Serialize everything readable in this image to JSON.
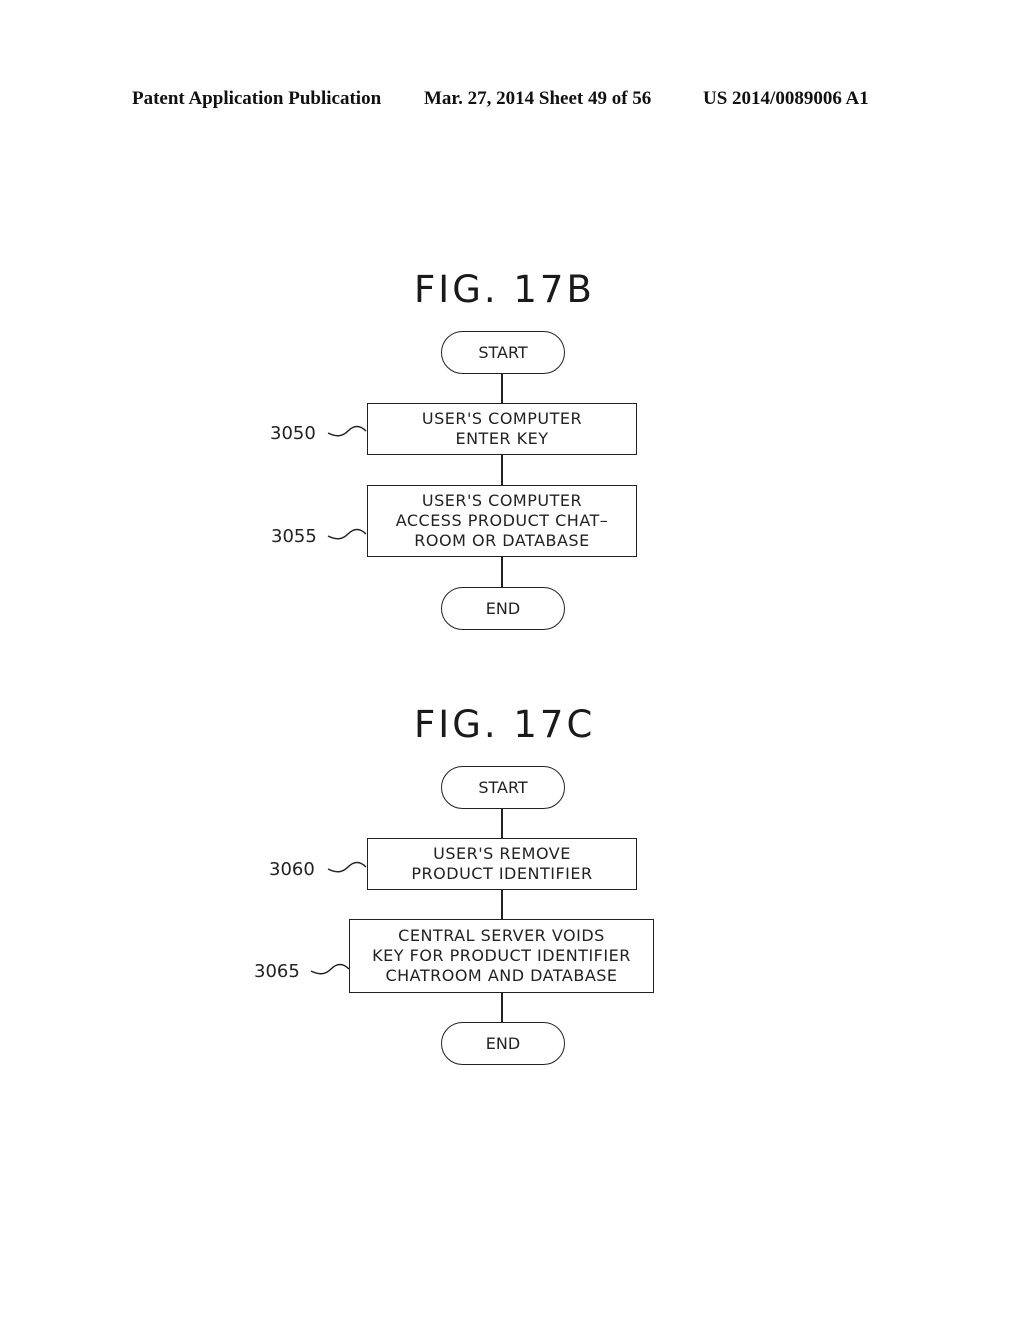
{
  "header": {
    "left": "Patent Application Publication",
    "middle": "Mar. 27, 2014  Sheet 49 of 56",
    "right": "US 2014/0089006 A1"
  },
  "fig17b": {
    "title": "FIG. 17B",
    "start": "START",
    "end": "END",
    "steps": [
      {
        "ref": "3050",
        "lines": [
          "USER'S COMPUTER",
          "ENTER KEY"
        ]
      },
      {
        "ref": "3055",
        "lines": [
          "USER'S COMPUTER",
          "ACCESS PRODUCT CHAT–",
          "ROOM OR DATABASE"
        ]
      }
    ]
  },
  "fig17c": {
    "title": "FIG. 17C",
    "start": "START",
    "end": "END",
    "steps": [
      {
        "ref": "3060",
        "lines": [
          "USER'S REMOVE",
          "PRODUCT IDENTIFIER"
        ]
      },
      {
        "ref": "3065",
        "lines": [
          "CENTRAL SERVER VOIDS",
          "KEY FOR PRODUCT IDENTIFIER",
          "CHATROOM AND DATABASE"
        ]
      }
    ]
  }
}
